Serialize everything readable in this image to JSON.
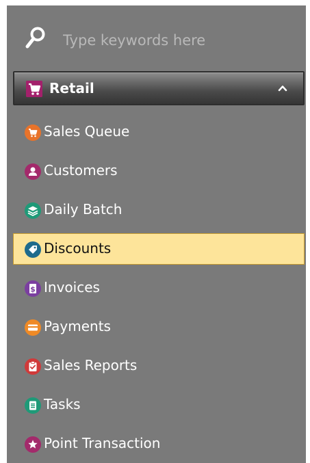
{
  "search": {
    "placeholder": "Type keywords here",
    "icon": "search-icon"
  },
  "section": {
    "label": "Retail",
    "icon": "cart-icon",
    "icon_color": "#a3206b",
    "expanded": true
  },
  "items": [
    {
      "label": "Sales Queue",
      "icon": "cart-icon",
      "color": "#e8732a",
      "selected": false
    },
    {
      "label": "Customers",
      "icon": "user-icon",
      "color": "#a32a6b",
      "selected": false
    },
    {
      "label": "Daily Batch",
      "icon": "layers-icon",
      "color": "#1f9a78",
      "selected": false
    },
    {
      "label": "Discounts",
      "icon": "tag-icon",
      "color": "#1f6b8c",
      "selected": true
    },
    {
      "label": "Invoices",
      "icon": "invoice-icon",
      "color": "#7b3fa0",
      "selected": false
    },
    {
      "label": "Payments",
      "icon": "card-icon",
      "color": "#ef8a26",
      "selected": false
    },
    {
      "label": "Sales Reports",
      "icon": "clipboard-icon",
      "color": "#d03a3a",
      "selected": false
    },
    {
      "label": "Tasks",
      "icon": "list-icon",
      "color": "#1f9a78",
      "selected": false
    },
    {
      "label": "Point Transaction",
      "icon": "star-icon",
      "color": "#a32a6b",
      "selected": false
    }
  ],
  "colors": {
    "panel_bg": "#7a7a7a",
    "selected_bg": "#fde49a",
    "selected_border": "#c79b2e"
  }
}
